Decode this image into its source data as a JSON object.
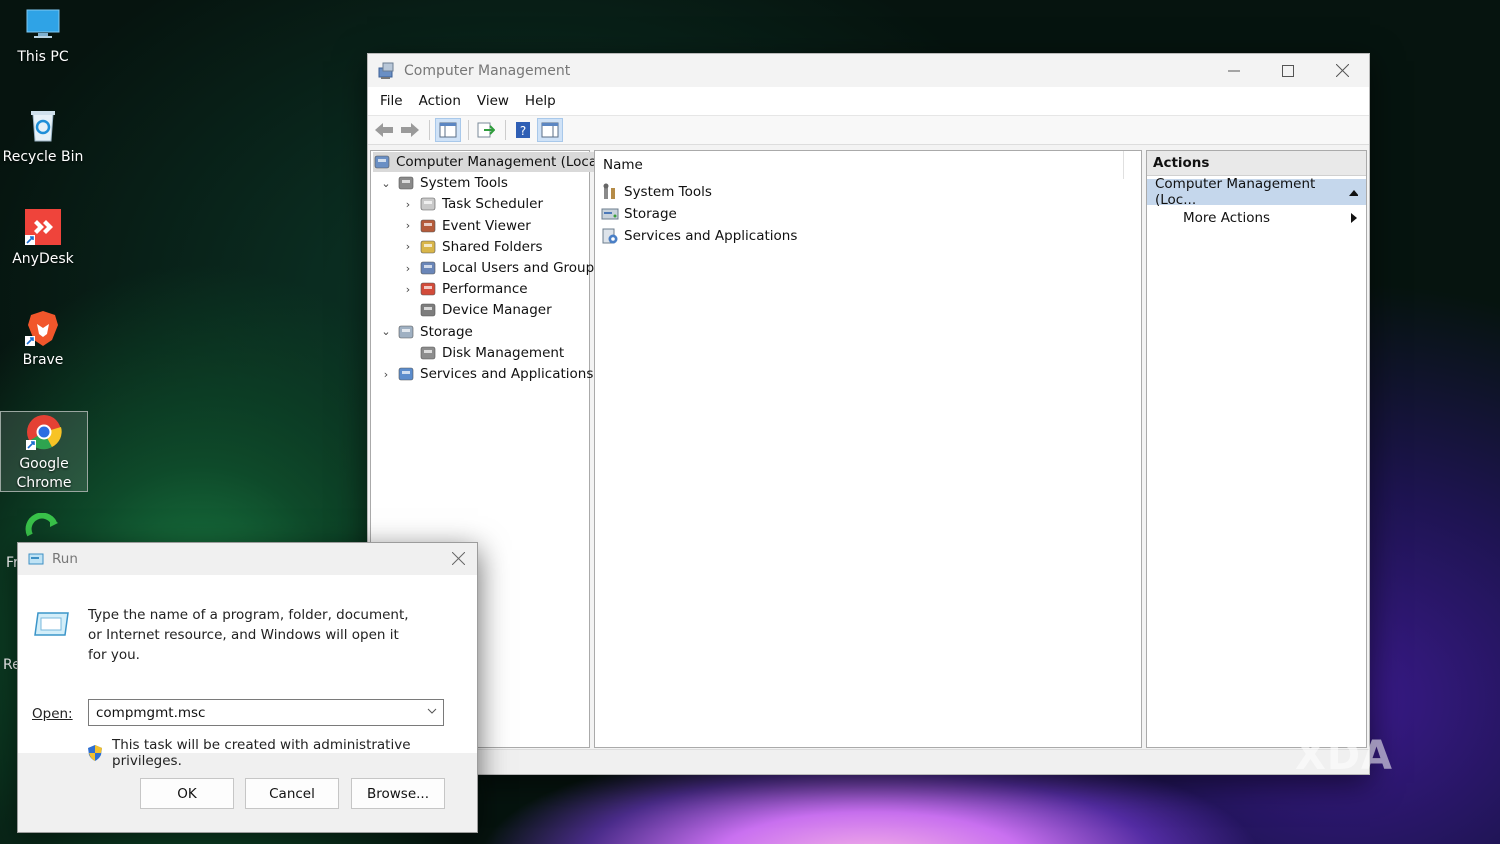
{
  "desktop": {
    "icons": [
      {
        "label": "This PC",
        "icon": "monitor-icon"
      },
      {
        "label": "Recycle Bin",
        "icon": "recycle-bin-icon"
      },
      {
        "label": "AnyDesk",
        "icon": "anydesk-icon"
      },
      {
        "label": "Brave",
        "icon": "brave-lion-icon"
      },
      {
        "label": "Google Chrome",
        "icon": "chrome-icon"
      }
    ],
    "partial_labels": [
      "Fr",
      "Re"
    ]
  },
  "computer_management": {
    "title": "Computer Management",
    "menu": [
      "File",
      "Action",
      "View",
      "Help"
    ],
    "tree": [
      {
        "label": "Computer Management (Local)",
        "level": 0,
        "expander": "",
        "icon": "computer-management-icon",
        "selected": true
      },
      {
        "label": "System Tools",
        "level": 1,
        "expander": "⌄",
        "icon": "system-tools-icon"
      },
      {
        "label": "Task Scheduler",
        "level": 2,
        "expander": "›",
        "icon": "clock-icon"
      },
      {
        "label": "Event Viewer",
        "level": 2,
        "expander": "›",
        "icon": "event-viewer-icon"
      },
      {
        "label": "Shared Folders",
        "level": 2,
        "expander": "›",
        "icon": "shared-folders-icon"
      },
      {
        "label": "Local Users and Groups",
        "level": 2,
        "expander": "›",
        "icon": "users-icon"
      },
      {
        "label": "Performance",
        "level": 2,
        "expander": "›",
        "icon": "performance-icon"
      },
      {
        "label": "Device Manager",
        "level": 2,
        "expander": "",
        "icon": "device-manager-icon"
      },
      {
        "label": "Storage",
        "level": 1,
        "expander": "⌄",
        "icon": "storage-icon"
      },
      {
        "label": "Disk Management",
        "level": 2,
        "expander": "",
        "icon": "disk-icon"
      },
      {
        "label": "Services and Applications",
        "level": 1,
        "expander": "›",
        "icon": "services-icon"
      }
    ],
    "list_header": "Name",
    "list_items": [
      "System Tools",
      "Storage",
      "Services and Applications"
    ],
    "actions": {
      "header": "Actions",
      "selected": "Computer Management (Loc...",
      "more": "More Actions"
    }
  },
  "run_dialog": {
    "title": "Run",
    "description": "Type the name of a program, folder, document, or Internet resource, and Windows will open it for you.",
    "open_label": "Open:",
    "open_value": "compmgmt.msc",
    "admin_note": "This task will be created with administrative privileges.",
    "buttons": {
      "ok": "OK",
      "cancel": "Cancel",
      "browse": "Browse..."
    }
  },
  "watermark": "XDA"
}
